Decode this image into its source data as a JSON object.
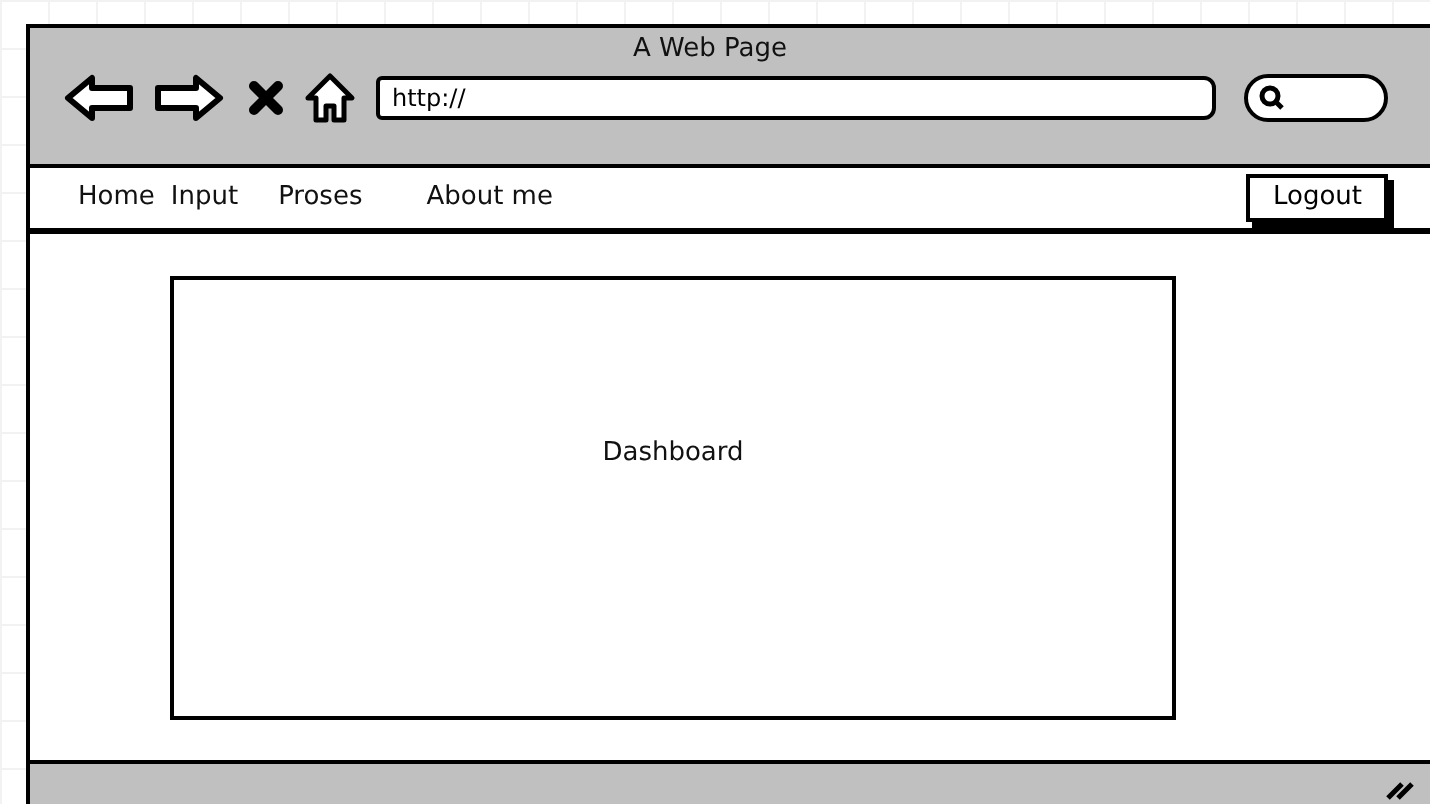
{
  "window": {
    "title": "A Web Page"
  },
  "toolbar": {
    "url": "http://"
  },
  "nav": {
    "links": [
      {
        "label": "Home"
      },
      {
        "label": "Input"
      },
      {
        "label": "Proses"
      },
      {
        "label": "About me"
      }
    ],
    "logout": "Logout"
  },
  "content": {
    "panel": "Dashboard"
  }
}
